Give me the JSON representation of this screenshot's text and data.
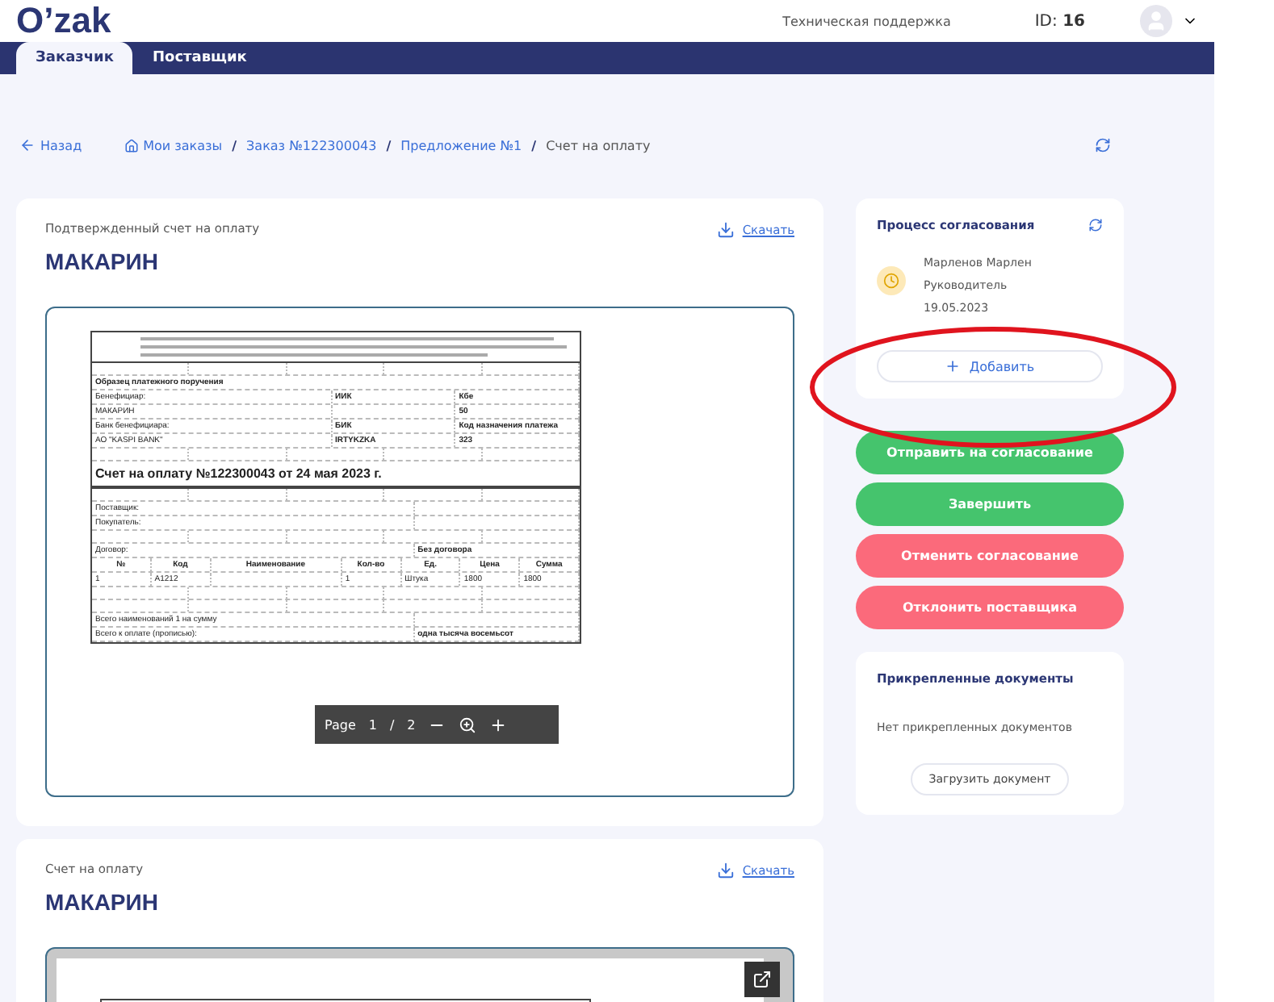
{
  "header": {
    "logo": "O’zak",
    "support_link": "Техническая поддержка",
    "id_label": "ID:",
    "id_value": "16"
  },
  "tabs": [
    {
      "label": "Заказчик",
      "selected": true
    },
    {
      "label": "Поставщик",
      "selected": false
    }
  ],
  "breadcrumb": {
    "back": "Назад",
    "separator": "/",
    "items": [
      "Мои заказы",
      "Заказ №122300043",
      "Предложение №1",
      "Счет на оплату"
    ]
  },
  "documents": [
    {
      "kind": "paged",
      "caption": "Подтвержденный счет на оплату",
      "title": "МАКАРИН",
      "download": "Скачать",
      "toolbar": {
        "page_label": "Page",
        "page": "1",
        "separator": "/",
        "total": "2"
      },
      "rows": [
        {
          "kind": "notice"
        },
        {
          "kind": "blank"
        },
        {
          "kind": "heading",
          "text": "Образец платежного поручения"
        },
        {
          "kind": "cells",
          "cells": [
            "Бенефициар:",
            "ИИК",
            "Кбе"
          ]
        },
        {
          "kind": "cells",
          "cells": [
            "МАКАРИН",
            "",
            "50"
          ]
        },
        {
          "kind": "cells",
          "cells": [
            "Банк бенефициара:",
            "БИК",
            "Код назначения платежа"
          ]
        },
        {
          "kind": "cells",
          "cells": [
            "АО \"KASPI BANK\"",
            "IRTYKZKA",
            "323"
          ]
        },
        {
          "kind": "blank"
        },
        {
          "kind": "title",
          "text": "Счет на оплату №122300043 от  24 мая 2023 г."
        },
        {
          "kind": "blank"
        },
        {
          "kind": "cells",
          "cells": [
            "Поставщик:",
            ""
          ]
        },
        {
          "kind": "cells",
          "cells": [
            "Покупатель:",
            ""
          ]
        },
        {
          "kind": "blank"
        },
        {
          "kind": "cells",
          "cells": [
            "Договор:",
            "Без договора"
          ]
        },
        {
          "kind": "header",
          "cells": [
            "№",
            "Код",
            "Наименование",
            "Кол-во",
            "Ед.",
            "Цена",
            "Сумма"
          ]
        },
        {
          "kind": "line",
          "cells": [
            "1",
            "A1212",
            "",
            "1",
            "Штука",
            "1800",
            "1800"
          ]
        },
        {
          "kind": "blank"
        },
        {
          "kind": "blank"
        },
        {
          "kind": "cells",
          "cells": [
            "Всего наименований 1 на сумму",
            ""
          ]
        },
        {
          "kind": "cells",
          "cells": [
            "Всего к оплате (прописью):",
            "одна тысяча восемьсот"
          ]
        }
      ]
    },
    {
      "kind": "expandable",
      "caption": "Счет на оплату",
      "title": "МАКАРИН",
      "download": "Скачать",
      "rows": [
        {
          "kind": "notice"
        }
      ]
    }
  ],
  "approval": {
    "title": "Процесс согласования",
    "approvers": [
      {
        "name": "Марленов Марлен",
        "role": "Руководитель",
        "date": "19.05.2023",
        "kind": "pending"
      }
    ],
    "add_button": "Добавить"
  },
  "actions": [
    {
      "label": "Отправить на согласование",
      "kind": "success"
    },
    {
      "label": "Завершить",
      "kind": "success"
    },
    {
      "label": "Отменить согласование",
      "kind": "danger"
    },
    {
      "label": "Отклонить поставщика",
      "kind": "danger"
    }
  ],
  "attachments": {
    "title": "Прикрепленные документы",
    "empty_text": "Нет прикрепленных документов",
    "upload_button": "Загрузить документ"
  }
}
